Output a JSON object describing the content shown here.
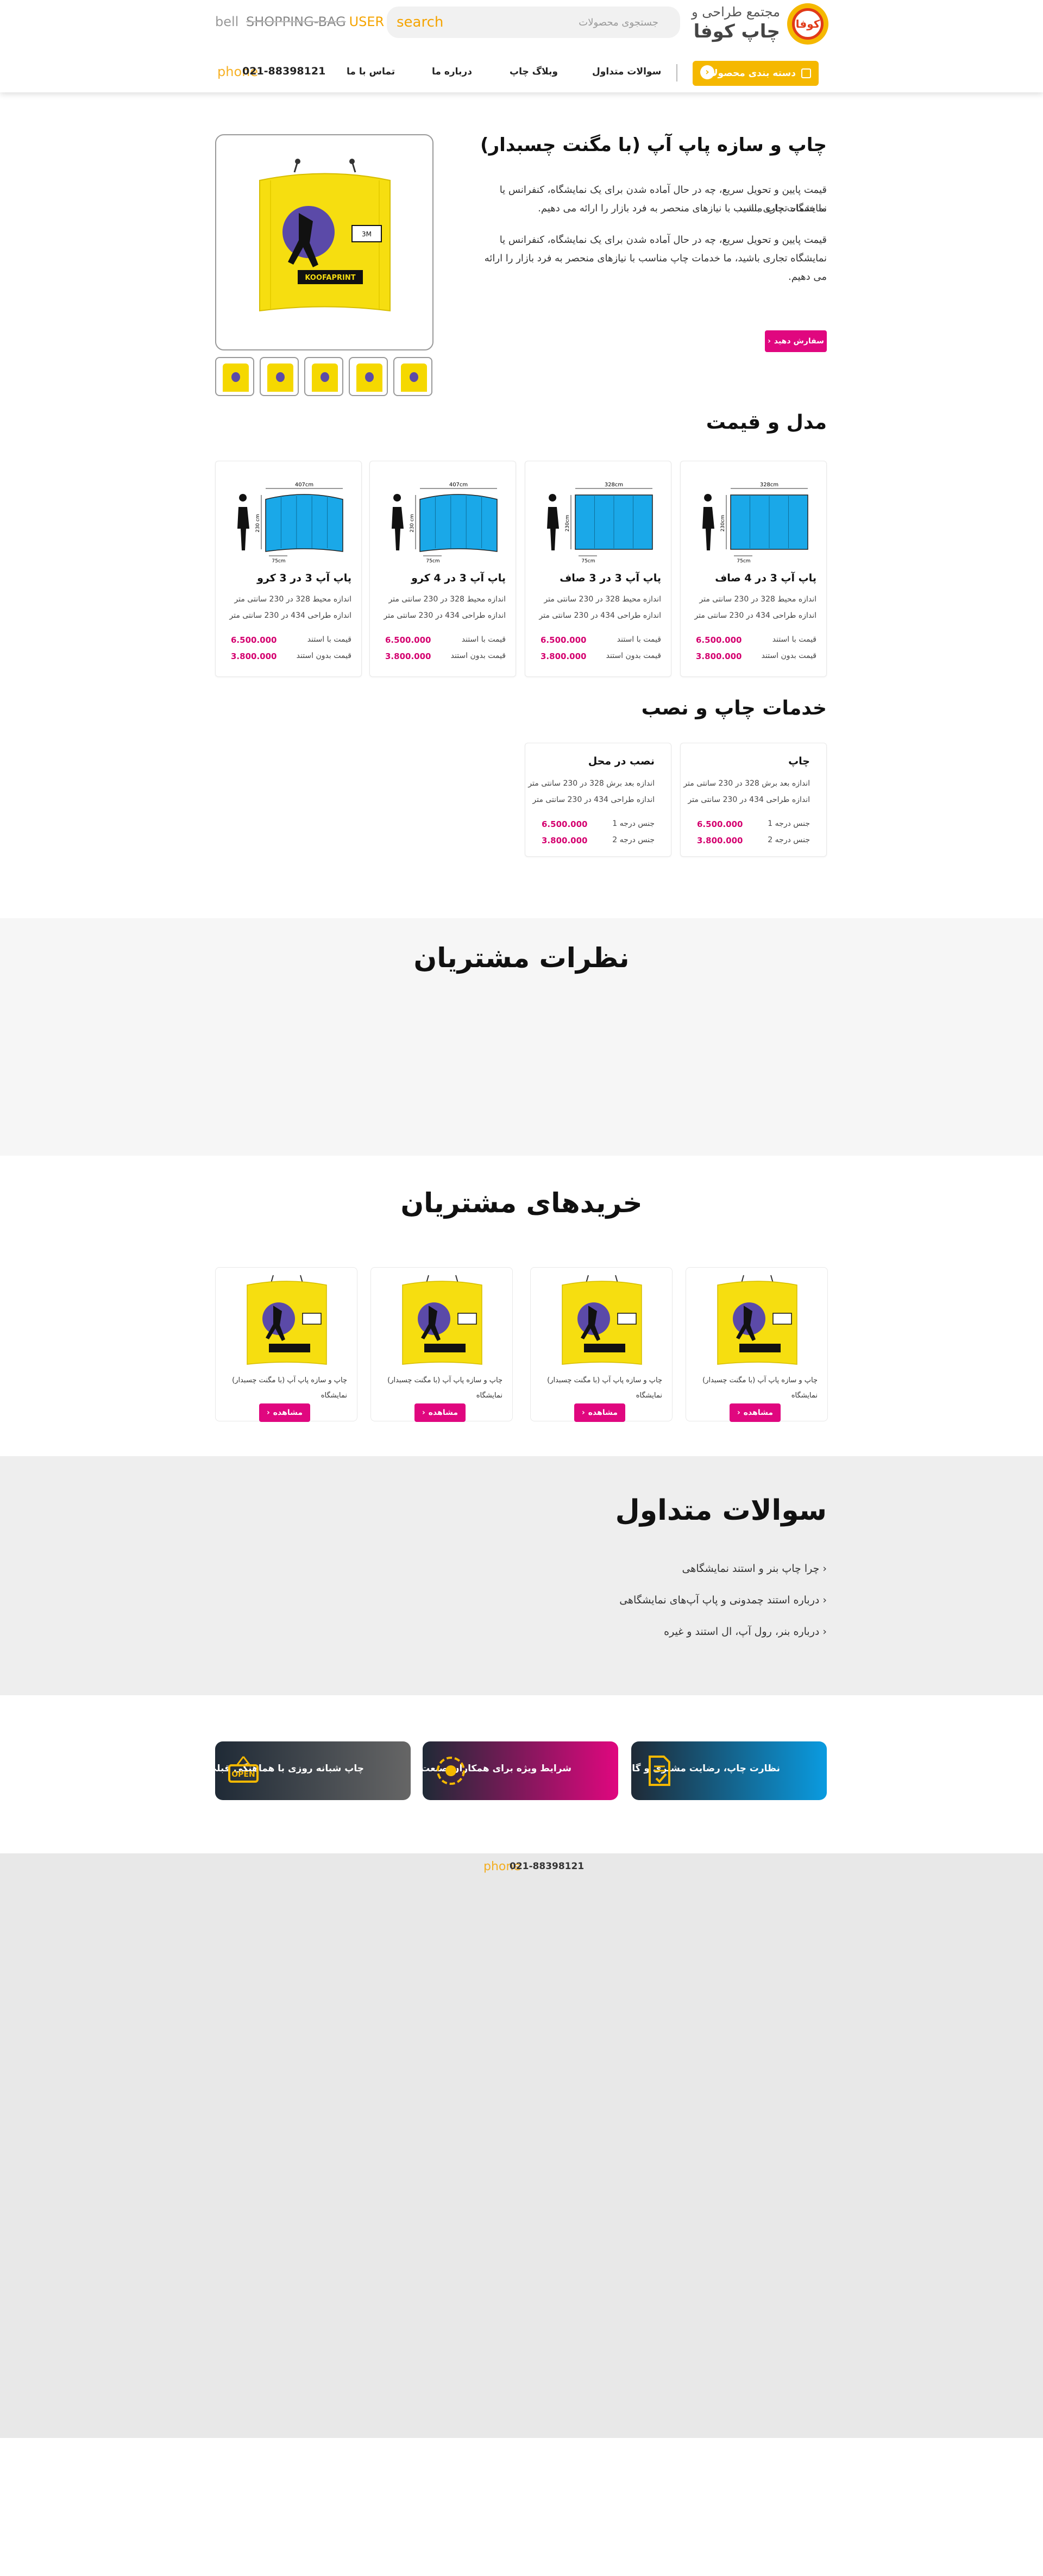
{
  "header": {
    "brand_sub": "مجتمع طراحی و",
    "brand_name": "چاپ کوفا",
    "logo_text": "کوفا",
    "search_placeholder": "search",
    "search_hint": "جستجوی محصولات",
    "icons": {
      "bell": "bell",
      "bag": "SHOPPING-BAG",
      "user": "USER"
    },
    "categories_button": "دسته بندی محصولات",
    "nav": [
      "سوالات متداول",
      "وبلاگ چاپ",
      "درباره ما",
      "تماس با ما"
    ],
    "phone_label": "phone",
    "phone_number": "021-88398121"
  },
  "product": {
    "title": "چاپ و سازه پاپ آپ (با مگنت چسبدار)",
    "desc_1": "قیمت پایین و تحویل سریع، چه در حال آماده شدن برای یک نمایشگاه، کنفرانس یا نمایشگاه تجاری باشید.",
    "desc_1b": "ما خدمات چاپ مناسب با نیازهای منحصر به فرد بازار را ارائه می دهیم.",
    "desc_2": "قیمت پایین و تحویل سریع، چه در حال آماده شدن برای یک نمایشگاه، کنفرانس یا نمایشگاه تجاری باشید، ما خدمات چاپ مناسب با نیازهای منحصر به فرد بازار را ارائه می دهیم.",
    "order_button": "سفارش دهید",
    "brand_on_banner": "KOOFAPRINT",
    "size_on_banner": "3M"
  },
  "models": {
    "heading": "مدل و قیمت",
    "price_with": "قیمت با استند",
    "price_without": "قیمت بدون استند",
    "items": [
      {
        "title": "پاپ آپ 3 در 4 صاف",
        "line1": "اندازه محیط 328 در 230 سانتی متر",
        "line2": "اندازه طراحی 434 در 230 سانتی متر",
        "price_with": "6.500.000",
        "price_without": "3.800.000",
        "w_label": "328cm",
        "h_label": "230cm",
        "d_label": "75cm"
      },
      {
        "title": "پاپ آپ 3 در 3 صاف",
        "line1": "اندازه محیط 328 در 230 سانتی متر",
        "line2": "اندازه طراحی 434 در 230 سانتی متر",
        "price_with": "6.500.000",
        "price_without": "3.800.000",
        "w_label": "328cm",
        "h_label": "230cm",
        "d_label": "75cm"
      },
      {
        "title": "پاپ آپ 3 در 4 کرو",
        "line1": "اندازه محیط 328 در 230 سانتی متر",
        "line2": "اندازه طراحی 434 در 230 سانتی متر",
        "price_with": "6.500.000",
        "price_without": "3.800.000",
        "w_label": "407cm",
        "h_label": "230 cm",
        "d_label": "75cm"
      },
      {
        "title": "پاپ آپ 3 در 3 کرو",
        "line1": "اندازه محیط 328 در 230 سانتی متر",
        "line2": "اندازه طراحی 434 در 230 سانتی متر",
        "price_with": "6.500.000",
        "price_without": "3.800.000",
        "w_label": "407cm",
        "h_label": "230 cm",
        "d_label": "75cm"
      }
    ]
  },
  "services": {
    "heading": "خدمات چاپ و نصب",
    "items": [
      {
        "title": "چاپ",
        "line1": "اندازه بعد برش 328 در 230 سانتی متر",
        "line2": "اندازه طراحی 434 در 230 سانتی متر",
        "row1_label": "جنس درجه 1",
        "row1_value": "6.500.000",
        "row2_label": "جنس درجه 2",
        "row2_value": "3.800.000"
      },
      {
        "title": "نصب در محل",
        "line1": "اندازه بعد برش 328 در 230 سانتی متر",
        "line2": "اندازه طراحی 434 در 230 سانتی متر",
        "row1_label": "جنس درجه 1",
        "row1_value": "6.500.000",
        "row2_label": "جنس درجه 2",
        "row2_value": "3.800.000"
      }
    ]
  },
  "reviews": {
    "heading": "نظرات مشتریان"
  },
  "purchases": {
    "heading": "خریدهای مشتریان",
    "items": [
      {
        "text": "چاپ و سازه پاپ آپ (با مگنت چسبدار) نمایشگاه",
        "button": "مشاهده"
      },
      {
        "text": "چاپ و سازه پاپ آپ (با مگنت چسبدار) نمایشگاه",
        "button": "مشاهده"
      },
      {
        "text": "چاپ و سازه پاپ آپ (با مگنت چسبدار) نمایشگاه",
        "button": "مشاهده"
      },
      {
        "text": "چاپ و سازه پاپ آپ (با مگنت چسبدار) نمایشگاه",
        "button": "مشاهده"
      }
    ]
  },
  "faq": {
    "heading": "سوالات متداول",
    "items": [
      "چرا چاپ بنر و استند نمایشگاهی",
      "درباره استند چمدونی و پاپ آپ‌های نمایشگاهی",
      "درباره بنر، رول آپ، ال استند و غیره"
    ]
  },
  "promos": [
    {
      "text": "نظارت چاپ، رضایت مشتری و گارانتی",
      "icon": "document-check-icon",
      "color_from": "#0a9be0",
      "color_to": "#1f2a36"
    },
    {
      "text": "شرایط ویژه برای همکاران صنعت چاپ",
      "icon": "color-wheel-icon",
      "color_from": "#e0077f",
      "color_to": "#1f2a36"
    },
    {
      "text": "چاپ شبانه روزی با هماهنگی قبلی",
      "icon": "open-sign-icon",
      "color_from": "#666666",
      "color_to": "#1f2a36"
    }
  ],
  "footer": {
    "phone_label": "phone",
    "phone_number": "021-88398121"
  },
  "colors": {
    "accent": "#f5b800",
    "pink": "#e0077f",
    "price": "#d4006f"
  }
}
